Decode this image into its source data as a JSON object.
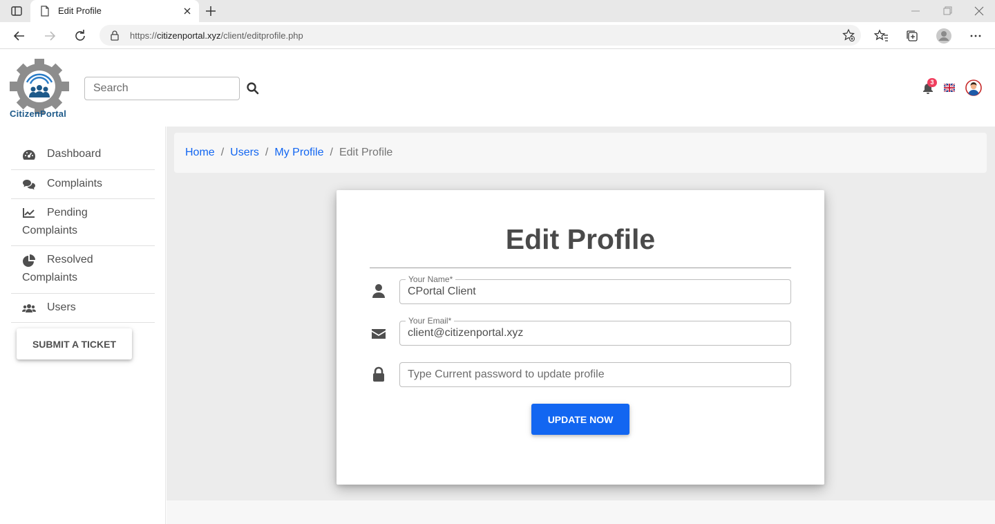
{
  "browser": {
    "tab_title": "Edit Profile",
    "url_scheme": "https://",
    "url_host": "citizenportal.xyz",
    "url_path": "/client/editprofile.php"
  },
  "header": {
    "logo_text": "CitizenPortal",
    "search_placeholder": "Search",
    "notification_count": "3"
  },
  "sidebar": {
    "items": [
      {
        "label": "Dashboard",
        "icon": "tachometer-icon"
      },
      {
        "label": "Complaints",
        "icon": "comments-icon"
      },
      {
        "label": "Pending Complaints",
        "icon": "chart-line-icon"
      },
      {
        "label": "Resolved Complaints",
        "icon": "chart-pie-icon"
      },
      {
        "label": "Users",
        "icon": "users-icon"
      }
    ],
    "submit_ticket_label": "SUBMIT A TICKET"
  },
  "breadcrumb": {
    "items": [
      "Home",
      "Users",
      "My Profile"
    ],
    "current": "Edit Profile"
  },
  "form": {
    "title": "Edit Profile",
    "name_label": "Your Name*",
    "name_value": "CPortal Client",
    "email_label": "Your Email*",
    "email_value": "client@citizenportal.xyz",
    "password_placeholder": "Type Current password to update profile",
    "submit_label": "UPDATE NOW"
  },
  "colors": {
    "primary": "#1266f1",
    "badge": "#f03e5e",
    "main_bg": "#ececec"
  }
}
